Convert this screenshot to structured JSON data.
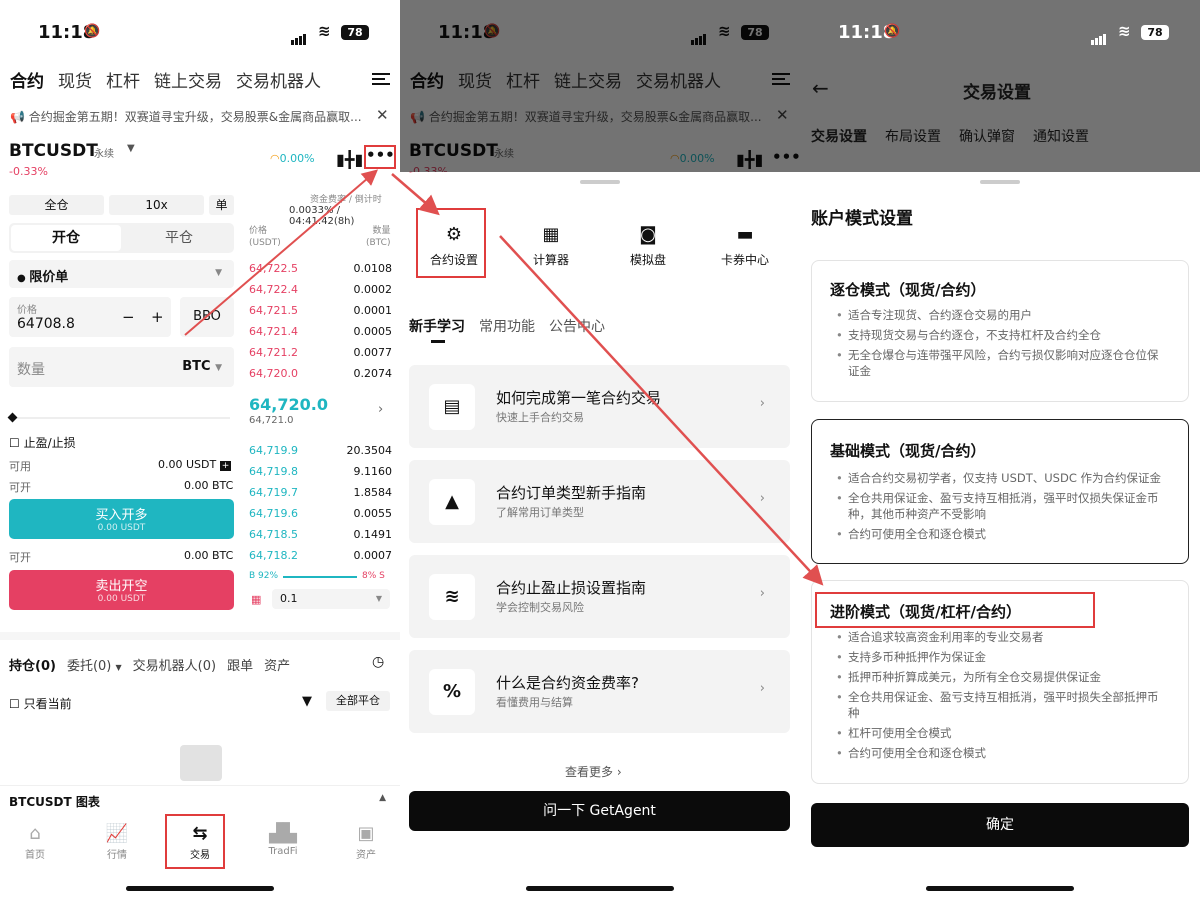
{
  "status": {
    "time": "11:18",
    "battery": "78"
  },
  "p1": {
    "tabs": [
      "合约",
      "现货",
      "杠杆",
      "链上交易",
      "交易机器人"
    ],
    "notice": "合约掘金第五期！双赛道寻宝升级，交易股票&金属商品赢取...",
    "pair": "BTCUSDT",
    "perp": "永续",
    "change": "-0.33%",
    "funding_pct": "0.00%",
    "margin_mode": "全仓",
    "leverage": "10x",
    "single": "单",
    "open_tab": "开仓",
    "close_tab": "平仓",
    "funding_label": "资金费率 / 倒计时",
    "funding_value": "0.0033% / 04:41:42(8h)",
    "order_type": "限价单",
    "price_label": "价格",
    "price_value": "64708.8",
    "minus": "−",
    "plus": "+",
    "bbo": "BBO",
    "qty_placeholder": "数量",
    "qty_unit": "BTC",
    "tpsl": "止盈/止损",
    "avail_label": "可用",
    "avail_value": "0.00 USDT",
    "open_label": "可开",
    "open_value1": "0.00 BTC",
    "open_value2": "0.00 BTC",
    "buy_label": "买入开多",
    "buy_sub": "0.00 USDT",
    "sell_label": "卖出开空",
    "sell_sub": "0.00 USDT",
    "ob_price_head": "价格\n(USDT)",
    "ob_qty_head": "数量\n(BTC)",
    "asks": [
      [
        "64,722.5",
        "0.0108"
      ],
      [
        "64,722.4",
        "0.0002"
      ],
      [
        "64,721.5",
        "0.0001"
      ],
      [
        "64,721.4",
        "0.0005"
      ],
      [
        "64,721.2",
        "0.0077"
      ],
      [
        "64,720.0",
        "0.2074"
      ]
    ],
    "last_price": "64,720.0",
    "mark_price": "64,721.0",
    "bids": [
      [
        "64,719.9",
        "20.3504"
      ],
      [
        "64,719.8",
        "9.1160"
      ],
      [
        "64,719.7",
        "1.8584"
      ],
      [
        "64,719.6",
        "0.0055"
      ],
      [
        "64,718.5",
        "0.1491"
      ],
      [
        "64,718.2",
        "0.0007"
      ]
    ],
    "b_ratio": "B 92%",
    "s_ratio": "8% S",
    "depth": "0.1",
    "pos_tabs": [
      "持仓(0)",
      "委托(0)",
      "交易机器人(0)",
      "跟单",
      "资产"
    ],
    "only_current": "只看当前",
    "close_all": "全部平仓",
    "chart_label": "BTCUSDT 图表",
    "nav": [
      "首页",
      "行情",
      "交易",
      "TradFi",
      "资产"
    ]
  },
  "p2": {
    "tools": [
      "合约设置",
      "计算器",
      "模拟盘",
      "卡券中心"
    ],
    "tabs": [
      "新手学习",
      "常用功能",
      "公告中心"
    ],
    "cards": [
      {
        "title": "如何完成第一笔合约交易",
        "sub": "快速上手合约交易"
      },
      {
        "title": "合约订单类型新手指南",
        "sub": "了解常用订单类型"
      },
      {
        "title": "合约止盈止损设置指南",
        "sub": "学会控制交易风险"
      },
      {
        "title": "什么是合约资金费率?",
        "sub": "看懂费用与结算"
      }
    ],
    "more": "查看更多",
    "agent": "问一下 GetAgent"
  },
  "p3": {
    "title": "交易设置",
    "tabs": [
      "交易设置",
      "布局设置",
      "确认弹窗",
      "通知设置"
    ],
    "heading": "账户模式设置",
    "modes": [
      {
        "title": "逐仓模式（现货/合约）",
        "items": [
          "适合专注现货、合约逐仓交易的用户",
          "支持现货交易与合约逐仓，不支持杠杆及合约全仓",
          "无全仓爆仓与连带强平风险，合约亏损仅影响对应逐仓仓位保证金"
        ]
      },
      {
        "title": "基础模式（现货/合约）",
        "items": [
          "适合合约交易初学者，仅支持 USDT、USDC 作为合约保证金",
          "全仓共用保证金、盈亏支持互相抵消，强平时仅损失保证金币种，其他币种资产不受影响",
          "合约可使用全仓和逐仓模式"
        ]
      },
      {
        "title": "进阶模式（现货/杠杆/合约）",
        "items": [
          "适合追求较高资金利用率的专业交易者",
          "支持多币种抵押作为保证金",
          "抵押币种折算成美元，为所有全仓交易提供保证金",
          "全仓共用保证金、盈亏支持互相抵消，强平时损失全部抵押币种",
          "杠杆可使用全仓模式",
          "合约可使用全仓和逐仓模式"
        ]
      }
    ],
    "confirm": "确定"
  },
  "colors": {
    "accent": "#1fb6c1",
    "sell": "#e54063",
    "highlight": "#e03c3c"
  }
}
